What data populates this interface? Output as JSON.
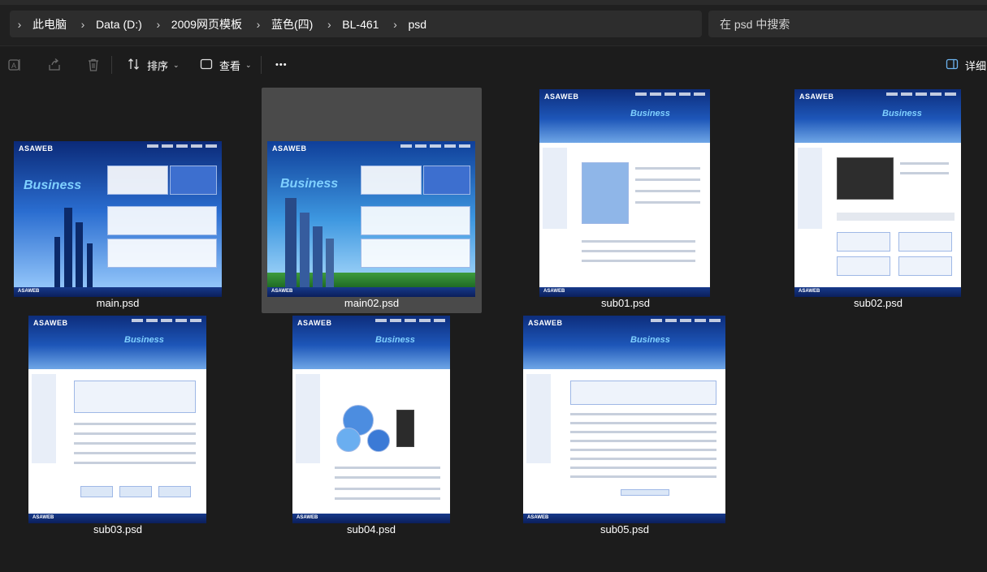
{
  "address_bar": {
    "breadcrumb": [
      {
        "label": "此电脑"
      },
      {
        "label": "Data (D:)"
      },
      {
        "label": "2009网页模板"
      },
      {
        "label": "蓝色(四)"
      },
      {
        "label": "BL-461"
      },
      {
        "label": "psd"
      }
    ],
    "search_placeholder": "在 psd 中搜索"
  },
  "command_bar": {
    "sort_label": "排序",
    "view_label": "查看",
    "more_label": "•••",
    "details_label": "详细"
  },
  "files": [
    {
      "name": "main.psd",
      "selected": false
    },
    {
      "name": "main02.psd",
      "selected": true
    },
    {
      "name": "sub01.psd",
      "selected": false
    },
    {
      "name": "sub02.psd",
      "selected": false
    },
    {
      "name": "sub03.psd",
      "selected": false
    },
    {
      "name": "sub04.psd",
      "selected": false
    },
    {
      "name": "sub05.psd",
      "selected": false
    }
  ],
  "thumb_text": {
    "logo": "ASAWEB",
    "business": "Business"
  },
  "colors": {
    "window_bg": "#1c1c1c",
    "address_bg": "#2d2d2d",
    "selection_bg": "#4a4a4a",
    "thumb_brand_blue": "#1d56b8"
  }
}
